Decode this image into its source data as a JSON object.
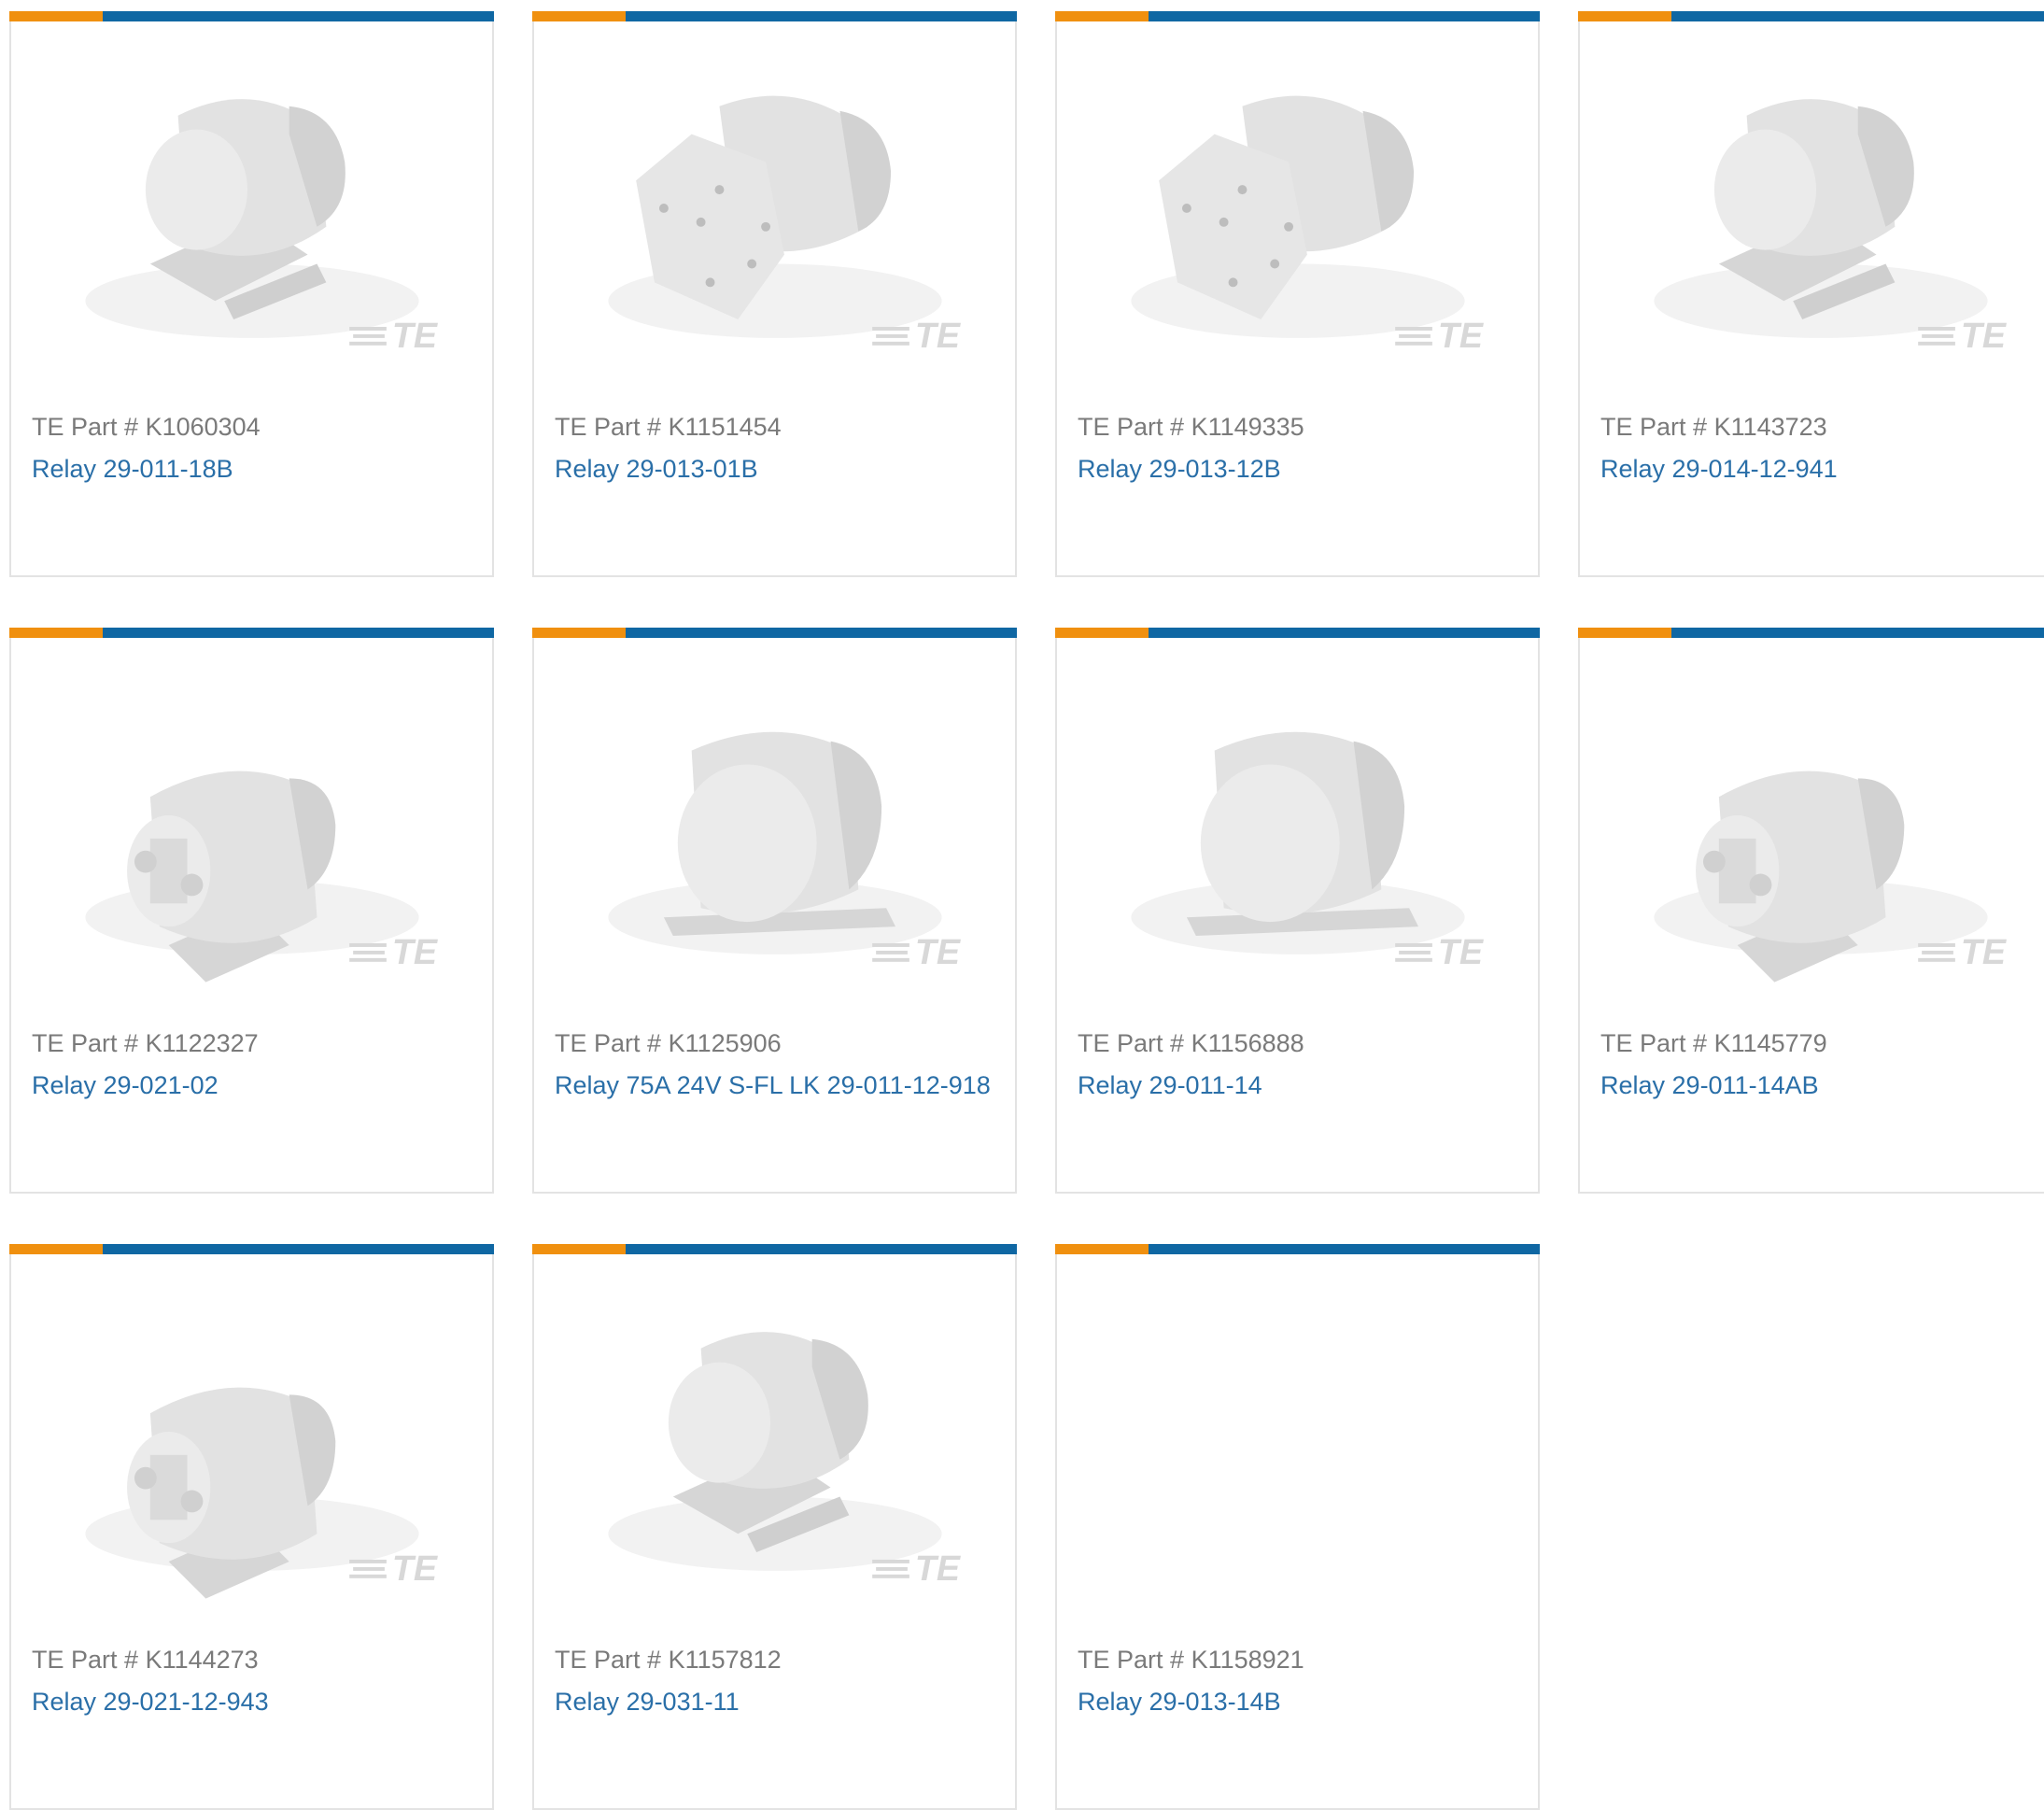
{
  "colors": {
    "accent_orange": "#f0900f",
    "accent_blue": "#0f67a3",
    "part_number_text": "#7a7a7a",
    "product_link": "#2a6fa8"
  },
  "card_labels": {
    "part_prefix": "TE Part #",
    "logo_text": "TE"
  },
  "products": [
    {
      "part_number": "K1060304",
      "name": "Relay 29-011-18B",
      "image": "relay-bracket-mount-icon"
    },
    {
      "part_number": "K1151454",
      "name": "Relay 29-013-01B",
      "image": "relay-plate-mount-icon"
    },
    {
      "part_number": "K1149335",
      "name": "Relay 29-013-12B",
      "image": "relay-plate-mount-icon"
    },
    {
      "part_number": "K1143723",
      "name": "Relay 29-014-12-941",
      "image": "relay-bracket-mount-icon"
    },
    {
      "part_number": "K1122327",
      "name": "Relay 29-021-02",
      "image": "relay-terminal-studs-icon"
    },
    {
      "part_number": "K1125906",
      "name": "Relay 75A 24V S-FL LK 29-011-12-918",
      "image": "relay-flat-base-icon"
    },
    {
      "part_number": "K1156888",
      "name": "Relay 29-011-14",
      "image": "relay-flat-base-icon"
    },
    {
      "part_number": "K1145779",
      "name": "Relay 29-011-14AB",
      "image": "relay-terminal-studs-icon"
    },
    {
      "part_number": "K1144273",
      "name": "Relay 29-021-12-943",
      "image": "relay-terminal-studs-icon"
    },
    {
      "part_number": "K1157812",
      "name": "Relay 29-031-11",
      "image": "relay-bracket-mount-icon"
    },
    {
      "part_number": "K1158921",
      "name": "Relay 29-013-14B",
      "image": ""
    }
  ]
}
